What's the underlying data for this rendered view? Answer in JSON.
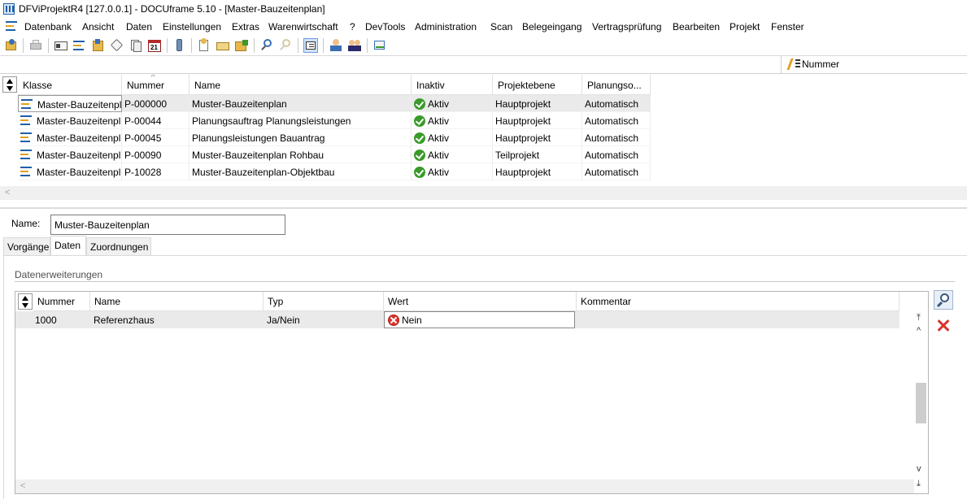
{
  "window": {
    "title": "DFViProjektR4 [127.0.0.1] - DOCUframe 5.10 - [Master-Bauzeitenplan]"
  },
  "menu": [
    "Datenbank",
    "Ansicht",
    "Daten",
    "Einstellungen",
    "Extras",
    "Warenwirtschaft",
    "?",
    "DevTools",
    "Administration",
    "Scan",
    "Belegeingang",
    "Vertragsprüfung",
    "Bearbeiten",
    "Projekt",
    "Fenster"
  ],
  "search": {
    "sort_field": "Nummer"
  },
  "top_grid": {
    "columns": [
      "Klasse",
      "Nummer",
      "Name",
      "Inaktiv",
      "Projektebene",
      "Planungso..."
    ],
    "rows": [
      {
        "klasse": "Master-Bauzeitenpl",
        "nummer": "P-000000",
        "name": "Muster-Bauzeitenplan",
        "inaktiv": "Aktiv",
        "ebene": "Hauptprojekt",
        "planung": "Automatisch"
      },
      {
        "klasse": "Master-Bauzeitenpl",
        "nummer": "P-00044",
        "name": "Planungsauftrag Planungsleistungen",
        "inaktiv": "Aktiv",
        "ebene": "Hauptprojekt",
        "planung": "Automatisch"
      },
      {
        "klasse": "Master-Bauzeitenpl",
        "nummer": "P-00045",
        "name": "Planungsleistungen Bauantrag",
        "inaktiv": "Aktiv",
        "ebene": "Hauptprojekt",
        "planung": "Automatisch"
      },
      {
        "klasse": "Master-Bauzeitenpl",
        "nummer": "P-00090",
        "name": "Muster-Bauzeitenplan Rohbau",
        "inaktiv": "Aktiv",
        "ebene": "Teilprojekt",
        "planung": "Automatisch"
      },
      {
        "klasse": "Master-Bauzeitenpl",
        "nummer": "P-10028",
        "name": "Muster-Bauzeitenplan-Objektbau",
        "inaktiv": "Aktiv",
        "ebene": "Hauptprojekt",
        "planung": "Automatisch"
      }
    ]
  },
  "detail": {
    "name_label": "Name:",
    "name_value": "Muster-Bauzeitenplan",
    "tabs": [
      "Vorgänge",
      "Daten",
      "Zuordnungen"
    ],
    "section_title": "Datenerweiterungen",
    "grid": {
      "columns": [
        "Nummer",
        "Name",
        "Typ",
        "Wert",
        "Kommentar"
      ],
      "rows": [
        {
          "nummer": "1000",
          "name": "Referenzhaus",
          "typ": "Ja/Nein",
          "wert": "Nein",
          "kommentar": ""
        }
      ]
    }
  },
  "icons": {
    "status_ok": "check-circle-icon",
    "status_no": "error-circle-icon",
    "delete": "red-x-icon",
    "find": "magnifier-icon"
  }
}
